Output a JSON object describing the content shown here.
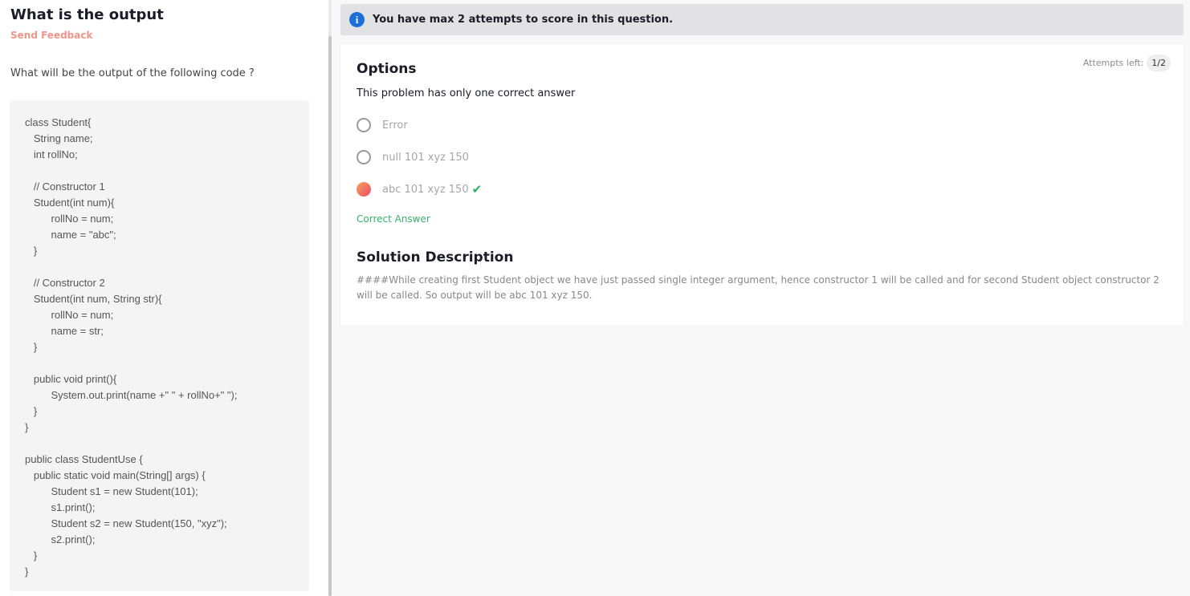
{
  "question": {
    "title": "What is the output",
    "feedback_label": "Send Feedback",
    "prompt": "What will be the output of the following code ?",
    "code": "class Student{\n   String name;\n   int rollNo;\n\n   // Constructor 1\n   Student(int num){\n         rollNo = num;\n         name = \"abc\";\n   }\n\n   // Constructor 2\n   Student(int num, String str){\n         rollNo = num;\n         name = str;\n   }\n\n   public void print(){\n         System.out.print(name +\" \" + rollNo+\" \");\n   }\n}\n\npublic class StudentUse {\n   public static void main(String[] args) {\n         Student s1 = new Student(101);\n         s1.print();\n         Student s2 = new Student(150, \"xyz\");\n         s2.print();\n   }\n}"
  },
  "banner": {
    "icon": "info-icon",
    "icon_glyph": "i",
    "text": "You have max 2 attempts to score in this question."
  },
  "options_panel": {
    "heading": "Options",
    "attempts_label": "Attempts left:",
    "attempts_value": "1/2",
    "instruction": "This problem has only one correct answer",
    "options": [
      {
        "label": "Error",
        "selected": false
      },
      {
        "label": "null 101 xyz 150",
        "selected": false
      },
      {
        "label": "abc 101 xyz 150",
        "selected": true,
        "correct_mark": "✔"
      }
    ],
    "correct_answer_label": "Correct Answer",
    "solution_heading": "Solution Description",
    "solution_text": "####While creating first Student object we have just passed single integer argument, hence constructor 1 will be called and for second Student object constructor 2 will be called. So output will be abc 101 xyz 150."
  },
  "colors": {
    "accent_info": "#1d6fd8",
    "feedback": "#f0958a",
    "correct": "#27b35a"
  }
}
